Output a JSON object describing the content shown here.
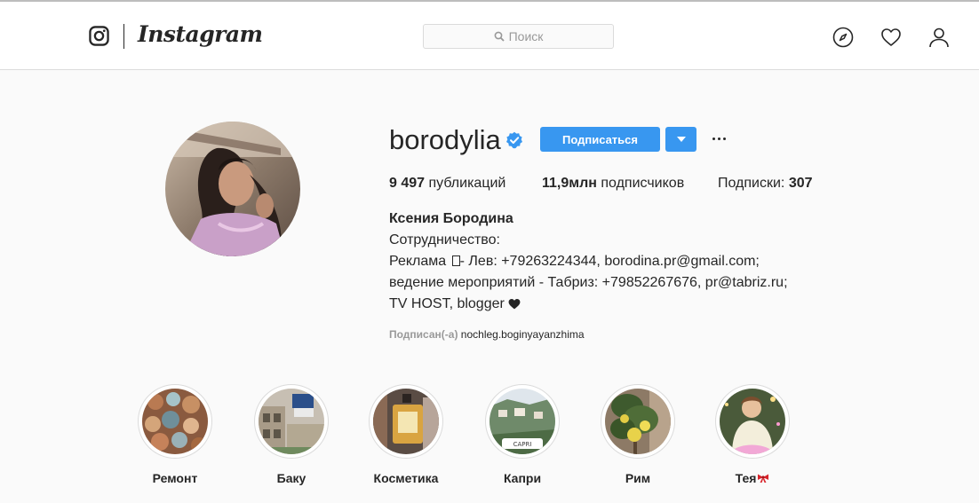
{
  "nav": {
    "wordmark": "Instagram",
    "search_placeholder": "Поиск"
  },
  "profile": {
    "username": "borodylia",
    "follow_label": "Подписаться",
    "stats": {
      "posts_count": "9 497",
      "posts_label": "публикаций",
      "followers_count": "11,9млн",
      "followers_label": "подписчиков",
      "following_label": "Подписки:",
      "following_count": "307"
    },
    "bio": {
      "name": "Ксения Бородина",
      "line1": "Сотрудничество:",
      "line2_a": "Реклама",
      "line2_b": "- Лев: +79263224344, borodina.pr@gmail.com;",
      "line3": "ведение мероприятий - Табриз: +79852267676, pr@tabriz.ru;",
      "line4": "TV HOST, blogger"
    },
    "followed_by_label": "Подписан(-а)",
    "followed_by_user": "nochleg.boginyayanzhima"
  },
  "highlights": [
    {
      "label": "Ремонт"
    },
    {
      "label": "Баку"
    },
    {
      "label": "Косметика"
    },
    {
      "label": "Капри",
      "badge": "CAPRI"
    },
    {
      "label": "Рим"
    },
    {
      "label": "Тея"
    }
  ],
  "colors": {
    "accent": "#3897f0",
    "text": "#262626",
    "muted": "#999999",
    "border": "#dbdbdb",
    "background": "#fafafa"
  },
  "icons": [
    "instagram-camera-icon",
    "search-icon",
    "compass-icon",
    "heart-icon",
    "user-icon",
    "verified-badge-icon",
    "chevron-down-icon",
    "more-icon",
    "black-heart-icon",
    "bow-emoji-icon"
  ]
}
